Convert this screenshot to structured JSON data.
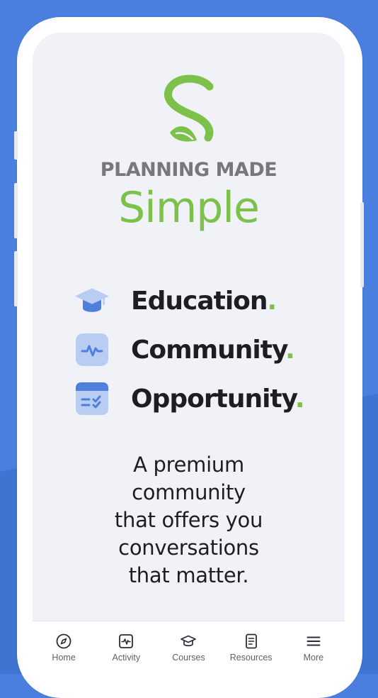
{
  "brand": {
    "logo_letter": "S",
    "line1": "PLANNING MADE",
    "line2": "Simple",
    "accent_color": "#7cc14a",
    "gray_color": "#77777c"
  },
  "features": [
    {
      "label": "Education",
      "dot": ".",
      "icon": "graduation-cap-icon"
    },
    {
      "label": "Community",
      "dot": ".",
      "icon": "activity-pulse-icon"
    },
    {
      "label": "Opportunity",
      "dot": ".",
      "icon": "calendar-checklist-icon"
    }
  ],
  "description": {
    "lines": [
      "A premium",
      "community",
      "that offers you",
      "conversations",
      "that matter."
    ]
  },
  "tabbar": {
    "items": [
      {
        "label": "Home",
        "icon": "compass-icon"
      },
      {
        "label": "Activity",
        "icon": "activity-icon"
      },
      {
        "label": "Courses",
        "icon": "graduation-cap-icon"
      },
      {
        "label": "Resources",
        "icon": "document-icon"
      },
      {
        "label": "More",
        "icon": "menu-icon"
      }
    ]
  },
  "colors": {
    "background": "#4a7fe0",
    "icon_blue": "#4f7fdc",
    "icon_light": "#b9cdf3"
  }
}
